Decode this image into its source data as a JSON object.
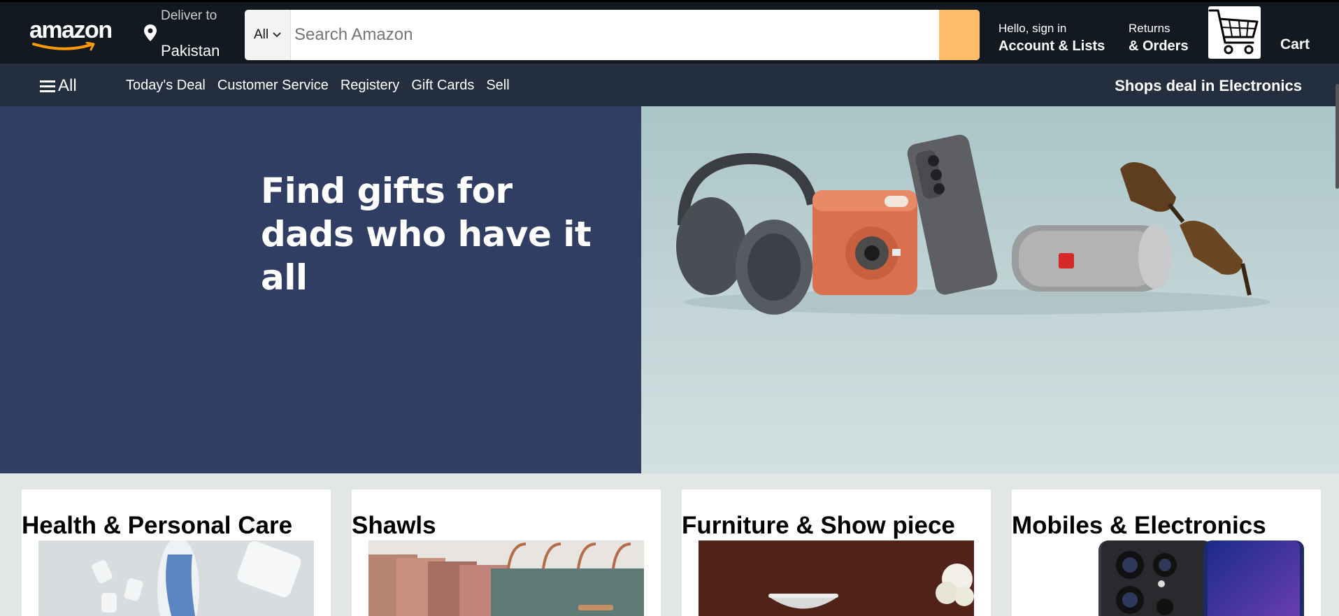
{
  "header": {
    "logo_text": "amazon",
    "deliver_label": "Deliver to",
    "deliver_location": "Pakistan",
    "search": {
      "category": "All",
      "placeholder": "Search Amazon"
    },
    "account": {
      "greeting": "Hello, sign in",
      "label": "Account & Lists"
    },
    "orders": {
      "top": "Returns",
      "label": "& Orders"
    },
    "cart_label": "Cart",
    "accent_color": "#febd69",
    "bar_color": "#131921"
  },
  "subnav": {
    "all_label": "All",
    "links": [
      "Today's Deal",
      "Customer Service",
      "Registery",
      "Gift Cards",
      "Sell"
    ],
    "promo": "Shops deal in Electronics",
    "bar_color": "#232f3e"
  },
  "hero": {
    "headline_line1": "Find gifts for",
    "headline_line2": "dads who have it all",
    "panel_color": "#303e63"
  },
  "categories": [
    {
      "title": "Health & Personal Care",
      "image_icon": "personal-care-products-image"
    },
    {
      "title": "Shawls",
      "image_icon": "shawls-image"
    },
    {
      "title": "Furniture & Show piece",
      "image_icon": "furniture-image"
    },
    {
      "title": "Mobiles & Electronics",
      "image_icon": "smartphone-image"
    }
  ]
}
